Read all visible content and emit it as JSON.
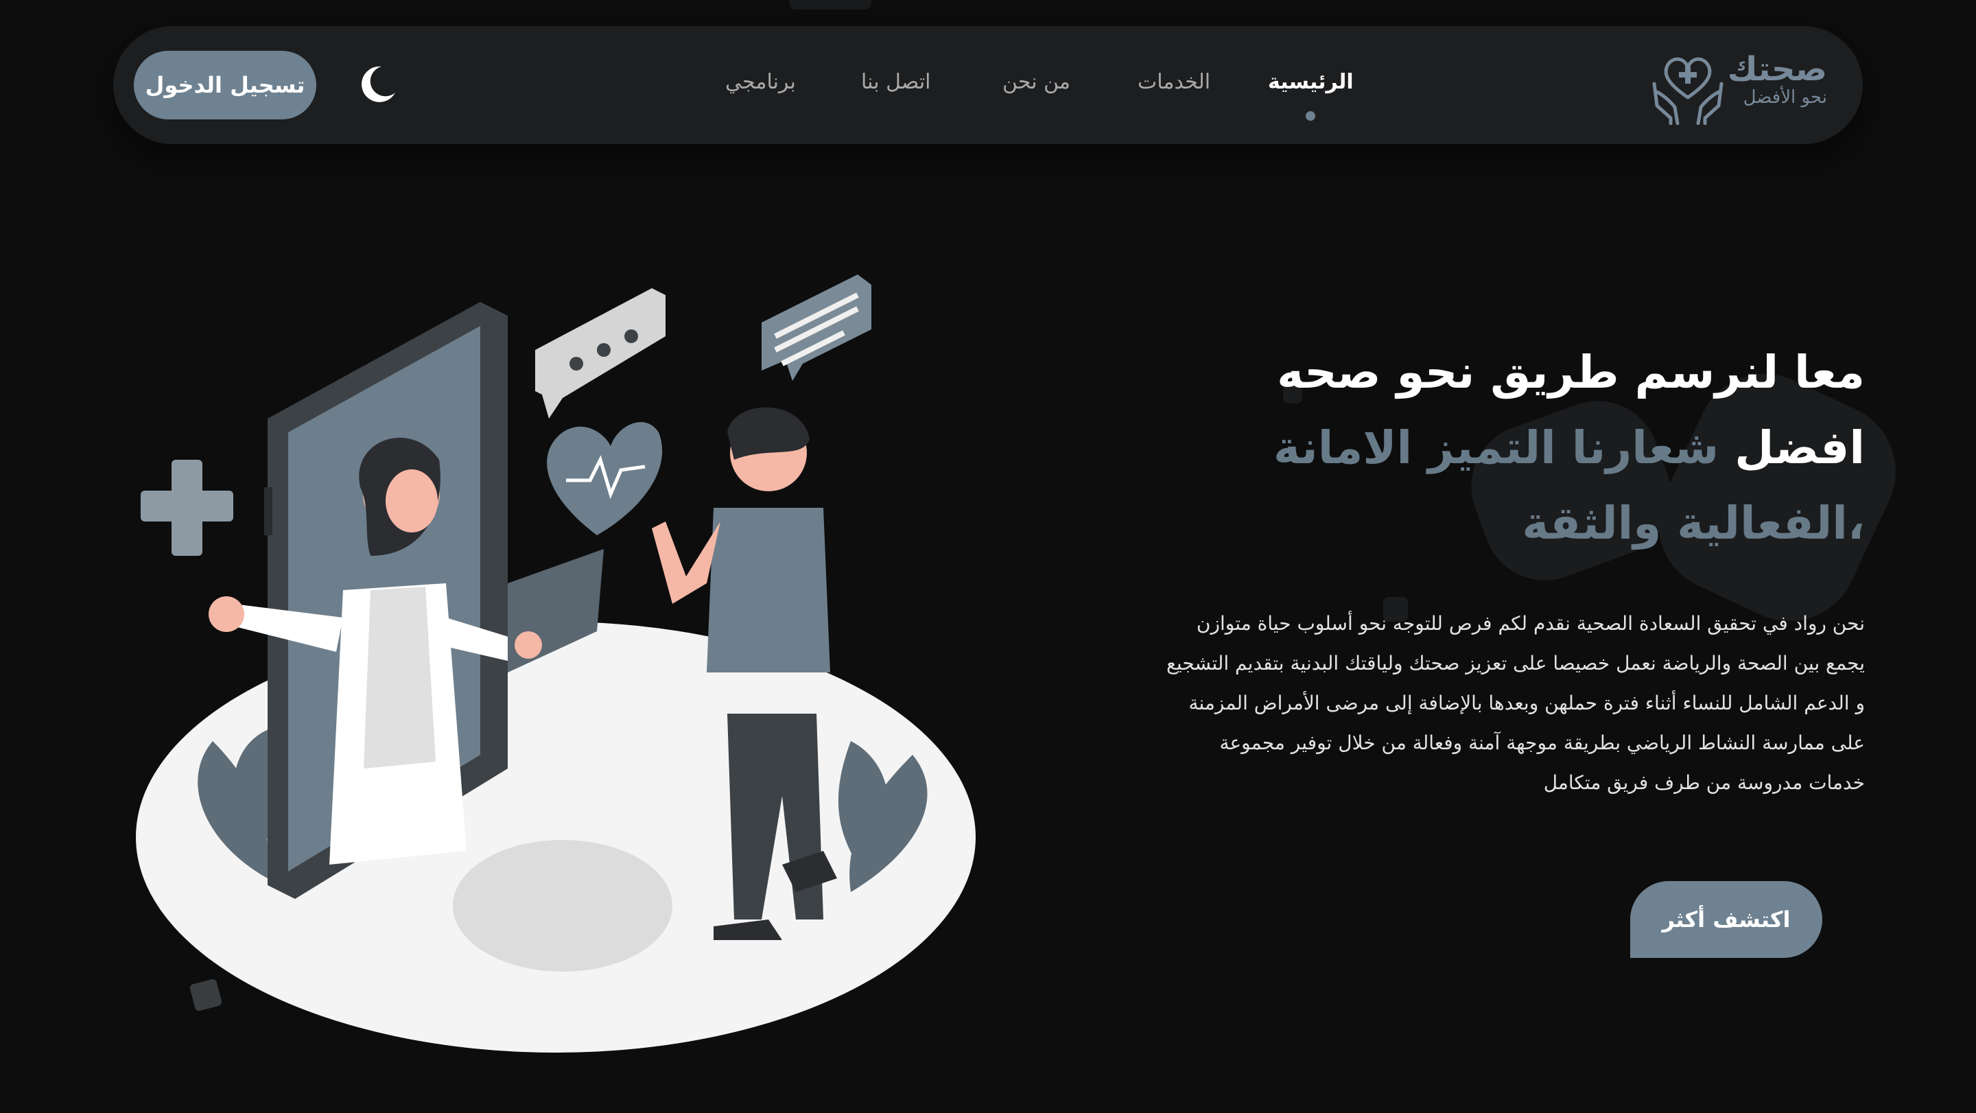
{
  "brand": {
    "name": "صحتك",
    "tagline": "نحو الأفضل",
    "logo_icon": "heart-hands-icon",
    "accent_color": "#6f8291"
  },
  "nav": {
    "items": [
      {
        "label": "الرئيسية",
        "active": true
      },
      {
        "label": "الخدمات",
        "active": false
      },
      {
        "label": "من نحن",
        "active": false
      },
      {
        "label": "اتصل بنا",
        "active": false
      },
      {
        "label": "برنامجي",
        "active": false
      }
    ],
    "theme_toggle_icon": "moon-icon",
    "login_label": "تسجيل الدخول"
  },
  "hero": {
    "title_main": "معا لنرسم طريق نحو صحه افضل",
    "title_accent": "شعارنا التميز الامانة ،الفعالية والثقة",
    "body": "نحن رواد في تحقيق السعادة الصحية نقدم لكم فرص للتوجه نحو أسلوب حياة متوازن يجمع بين الصحة والرياضة نعمل خصيصا على تعزيز صحتك ولياقتك البدنية بتقديم التشجيع و الدعم الشامل للنساء أثناء فترة حملهن وبعدها بالإضافة إلى مرضى الأمراض المزمنة على ممارسة النشاط الرياضي بطريقة موجهة آمنة وفعالة من خلال توفير مجموعة خدمات مدروسة من طرف فريق متكامل",
    "cta_label": "اكتشف أكثر",
    "illustration": "telemedicine-doctor-patient-illustration"
  },
  "colors": {
    "background": "#0d0d0e",
    "header_bg": "#1d1e20",
    "accent": "#6f8291",
    "accent_text": "#677a88"
  }
}
